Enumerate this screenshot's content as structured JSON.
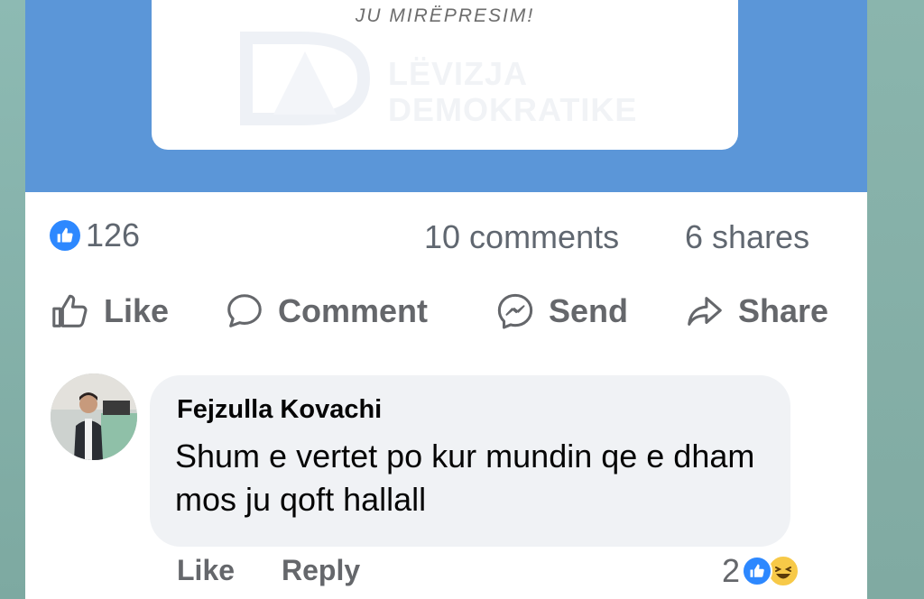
{
  "banner": {
    "tagline": "JU MIRËPRESIM!",
    "watermark_line1": "LËVIZJA",
    "watermark_line2": "DEMOKRATIKE"
  },
  "stats": {
    "like_count": "126",
    "comments": "10 comments",
    "shares": "6 shares"
  },
  "actions": {
    "like": "Like",
    "comment": "Comment",
    "send": "Send",
    "share": "Share"
  },
  "comment": {
    "author": "Fejzulla Kovachi",
    "text": "Shum e vertet  po kur mundin qe e dham mos ju qoft hallall",
    "like_label": "Like",
    "reply_label": "Reply",
    "reaction_count": "2",
    "reaction_icons": [
      "like-icon",
      "haha-icon"
    ]
  },
  "colors": {
    "banner_blue": "#5b96d8",
    "facebook_blue": "#2d88ff",
    "secondary_text": "#65676b",
    "bubble_bg": "#f0f2f5"
  }
}
